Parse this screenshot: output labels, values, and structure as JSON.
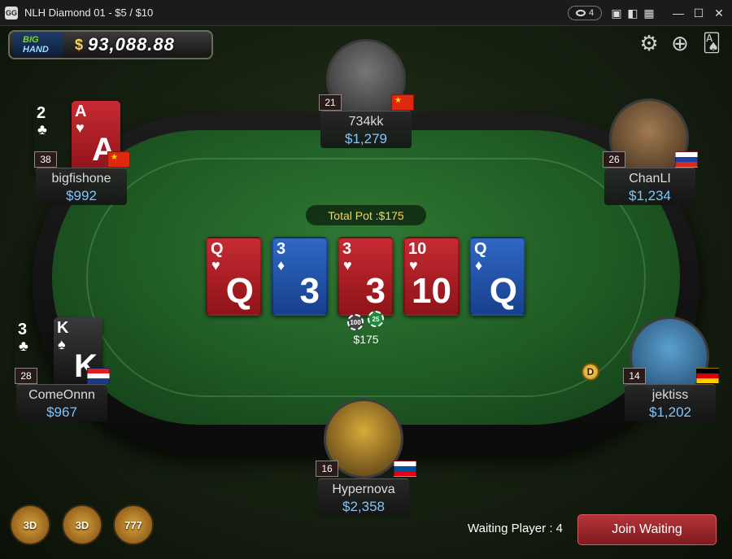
{
  "window": {
    "title": "NLH Diamond 01 - $5 / $10",
    "viewers": "4",
    "app_logo": "GG"
  },
  "balance": {
    "logo_top": "BIG",
    "logo_bottom": "HAND",
    "currency": "$",
    "amount": "93,088.88"
  },
  "icons": {
    "settings": "gear-icon",
    "target": "crosshair-icon",
    "cards": "card-icon"
  },
  "table": {
    "pot_label": "Total Pot :$175",
    "board": [
      {
        "rank": "Q",
        "suit": "♥",
        "color": "red"
      },
      {
        "rank": "3",
        "suit": "♦",
        "color": "blue"
      },
      {
        "rank": "3",
        "suit": "♥",
        "color": "red"
      },
      {
        "rank": "10",
        "suit": "♥",
        "color": "red"
      },
      {
        "rank": "Q",
        "suit": "♦",
        "color": "blue"
      }
    ],
    "chips": [
      "100",
      "25"
    ],
    "bet": "$175",
    "dealer_button": "D"
  },
  "players": {
    "top": {
      "name": "734kk",
      "chips": "$1,279",
      "level": "21",
      "flag": "cn"
    },
    "top_left": {
      "name": "bigfishone",
      "chips": "$992",
      "level": "38",
      "flag": "cn",
      "cards": [
        {
          "rank": "2",
          "suit": "♣",
          "color": "green"
        },
        {
          "rank": "A",
          "suit": "♥",
          "color": "red"
        }
      ]
    },
    "top_right": {
      "name": "ChanLI",
      "chips": "$1,234",
      "level": "26",
      "flag": "ru"
    },
    "mid_left": {
      "name": "ComeOnnn",
      "chips": "$967",
      "level": "28",
      "flag": "hr",
      "cards": [
        {
          "rank": "3",
          "suit": "♣",
          "color": "green"
        },
        {
          "rank": "K",
          "suit": "♠",
          "color": "black"
        }
      ]
    },
    "mid_right": {
      "name": "jektiss",
      "chips": "$1,202",
      "level": "14",
      "flag": "de"
    },
    "bottom": {
      "name": "Hypernova",
      "chips": "$2,358",
      "level": "16",
      "flag": "si"
    }
  },
  "footer": {
    "games": [
      "3D",
      "3D",
      "777"
    ],
    "waiting_text": "Waiting Player : 4",
    "join_label": "Join Waiting"
  }
}
